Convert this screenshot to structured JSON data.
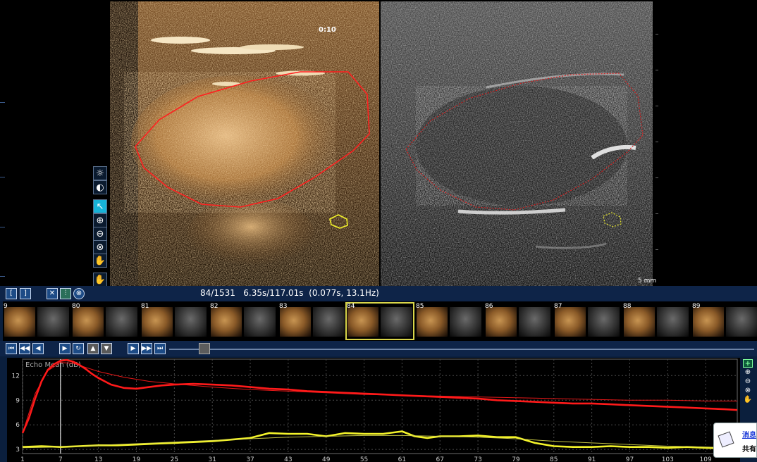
{
  "viewer": {
    "timer": "0:10",
    "scale_label": "5 mm"
  },
  "frame_info": "84/1531   6.35s/117.01s  (0.077s, 13.1Hz)",
  "thumbnails": [
    {
      "label": "9"
    },
    {
      "label": "80"
    },
    {
      "label": "81"
    },
    {
      "label": "82"
    },
    {
      "label": "83"
    },
    {
      "label": "84",
      "selected": true
    },
    {
      "label": "85"
    },
    {
      "label": "86"
    },
    {
      "label": "87"
    },
    {
      "label": "88"
    },
    {
      "label": "89"
    }
  ],
  "image_tools": [
    {
      "icon": "brightness-icon",
      "glyph": "☼"
    },
    {
      "icon": "contrast-icon",
      "glyph": "◐"
    },
    {
      "icon": "pointer-arrow-icon",
      "glyph": "↖",
      "active": true
    },
    {
      "icon": "zoom-in-icon",
      "glyph": "⊕"
    },
    {
      "icon": "zoom-out-icon",
      "glyph": "⊖"
    },
    {
      "icon": "zoom-reset-icon",
      "glyph": "⊗"
    },
    {
      "icon": "pan-hand-icon",
      "glyph": "✋"
    },
    {
      "icon": "grab-hand-icon",
      "glyph": "✋"
    }
  ],
  "colors": {
    "roi_red": "#ff1f1f",
    "roi_yellow": "#f2f22a",
    "panel_bg": "#0b1f3d"
  },
  "chart_data": {
    "type": "line",
    "title": "",
    "ylabel": "Echo Mean (dB)",
    "xlabel": "",
    "x_ticks": [
      1,
      7,
      13,
      19,
      25,
      31,
      37,
      43,
      49,
      55,
      61,
      67,
      73,
      79,
      85,
      91,
      97,
      103,
      109
    ],
    "y_ticks": [
      3,
      6,
      9,
      12
    ],
    "xlim": [
      1,
      114
    ],
    "ylim": [
      2.5,
      14
    ],
    "cursor_x": 7,
    "series": [
      {
        "color": "#ff1a1a",
        "style": "measured",
        "x": [
          1,
          2,
          3,
          4,
          5,
          6,
          7,
          8,
          9,
          10,
          11,
          12,
          13,
          15,
          17,
          19,
          21,
          23,
          25,
          28,
          31,
          34,
          37,
          40,
          43,
          46,
          49,
          52,
          55,
          58,
          61,
          64,
          67,
          70,
          73,
          76,
          79,
          82,
          85,
          88,
          91,
          94,
          97,
          100,
          103,
          106,
          109,
          112,
          114
        ],
        "values": [
          5.0,
          6.8,
          9.2,
          11.3,
          12.7,
          13.4,
          13.8,
          13.9,
          13.7,
          13.3,
          12.8,
          12.2,
          11.7,
          10.9,
          10.5,
          10.4,
          10.6,
          10.8,
          10.9,
          11.0,
          10.9,
          10.8,
          10.6,
          10.4,
          10.3,
          10.1,
          10.0,
          9.9,
          9.8,
          9.7,
          9.6,
          9.5,
          9.4,
          9.3,
          9.2,
          9.0,
          8.9,
          8.8,
          8.7,
          8.6,
          8.6,
          8.5,
          8.4,
          8.3,
          8.2,
          8.1,
          8.0,
          7.9,
          7.8
        ]
      },
      {
        "color": "#ff1a1a",
        "style": "fit",
        "x": [
          1,
          3,
          5,
          7,
          9,
          11,
          13,
          17,
          21,
          25,
          31,
          37,
          43,
          49,
          55,
          61,
          67,
          73,
          79,
          85,
          91,
          97,
          103,
          109,
          114
        ],
        "values": [
          5.0,
          9.8,
          12.6,
          13.6,
          13.5,
          13.0,
          12.5,
          11.8,
          11.3,
          11.0,
          10.6,
          10.3,
          10.1,
          9.9,
          9.7,
          9.6,
          9.5,
          9.4,
          9.3,
          9.2,
          9.1,
          9.0,
          9.0,
          8.9,
          8.9
        ]
      },
      {
        "color": "#f4f42a",
        "style": "measured",
        "x": [
          1,
          4,
          7,
          10,
          13,
          16,
          19,
          22,
          25,
          28,
          31,
          34,
          37,
          40,
          43,
          46,
          49,
          52,
          55,
          58,
          61,
          63,
          65,
          67,
          70,
          73,
          76,
          79,
          82,
          85,
          88,
          91,
          94,
          97,
          100,
          103,
          106,
          109,
          112,
          114
        ],
        "values": [
          3.3,
          3.4,
          3.3,
          3.4,
          3.5,
          3.5,
          3.6,
          3.7,
          3.8,
          3.9,
          4.0,
          4.2,
          4.4,
          5.0,
          4.9,
          4.9,
          4.6,
          5.0,
          4.9,
          4.9,
          5.2,
          4.6,
          4.4,
          4.6,
          4.6,
          4.7,
          4.5,
          4.5,
          3.8,
          3.4,
          3.3,
          3.3,
          3.4,
          3.3,
          3.3,
          3.2,
          3.3,
          3.2,
          3.1,
          3.0
        ]
      },
      {
        "color": "#d8d84a",
        "style": "fit",
        "x": [
          1,
          7,
          13,
          19,
          25,
          31,
          37,
          43,
          49,
          55,
          61,
          67,
          73,
          79,
          85,
          91,
          97,
          103,
          109,
          114
        ],
        "values": [
          3.2,
          3.3,
          3.5,
          3.7,
          3.9,
          4.1,
          4.3,
          4.5,
          4.6,
          4.7,
          4.7,
          4.6,
          4.5,
          4.3,
          4.0,
          3.8,
          3.6,
          3.4,
          3.3,
          3.2
        ]
      }
    ]
  },
  "popup": {
    "line1": "消息",
    "line2": "共有"
  }
}
